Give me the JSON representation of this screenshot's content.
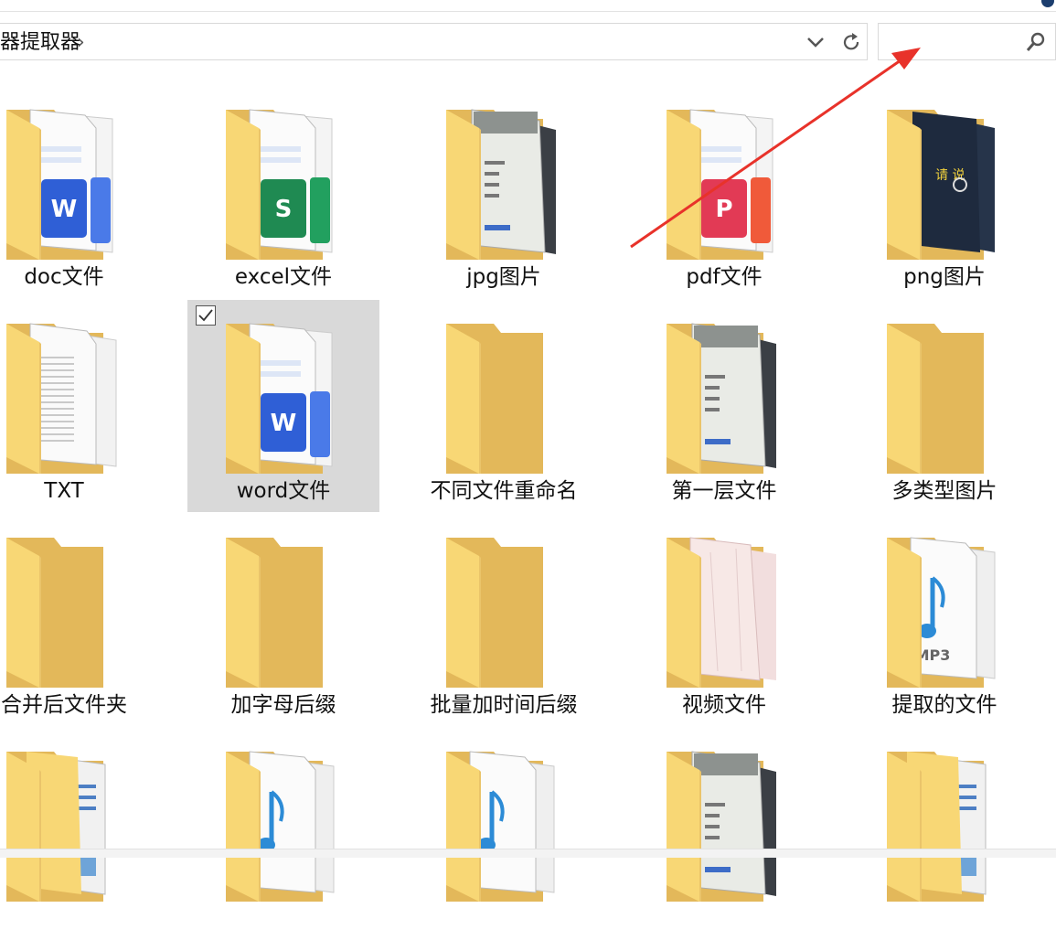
{
  "address_bar": {
    "breadcrumb": "器提取器",
    "separator": "›"
  },
  "search": {
    "placeholder": "",
    "value": ""
  },
  "colors": {
    "folder_back": "#e3b85a",
    "folder_front": "#f8d775",
    "selection": "#d9d9d9",
    "arrow": "#e8322a"
  },
  "items": [
    {
      "label": "doc文件",
      "thumb": "word-doc",
      "selected": false
    },
    {
      "label": "excel文件",
      "thumb": "excel-doc",
      "selected": false
    },
    {
      "label": "jpg图片",
      "thumb": "image-pages",
      "selected": false
    },
    {
      "label": "pdf文件",
      "thumb": "pdf-doc",
      "selected": false
    },
    {
      "label": "png图片",
      "thumb": "dark-image",
      "selected": false
    },
    {
      "label": "TXT",
      "thumb": "text-pages",
      "selected": false
    },
    {
      "label": "word文件",
      "thumb": "word-doc",
      "selected": true
    },
    {
      "label": "不同文件重命名",
      "thumb": "empty",
      "selected": false
    },
    {
      "label": "第一层文件",
      "thumb": "image-pages",
      "selected": false
    },
    {
      "label": "多类型图片",
      "thumb": "empty",
      "selected": false
    },
    {
      "label": "合并后文件夹",
      "thumb": "empty",
      "selected": false
    },
    {
      "label": "加字母后缀",
      "thumb": "empty",
      "selected": false
    },
    {
      "label": "批量加时间后缀",
      "thumb": "empty",
      "selected": false
    },
    {
      "label": "视频文件",
      "thumb": "pink-pages",
      "selected": false
    },
    {
      "label": "提取的文件",
      "thumb": "mp3-doc",
      "selected": false
    },
    {
      "label": "",
      "thumb": "blue-doc",
      "selected": false
    },
    {
      "label": "",
      "thumb": "music-doc",
      "selected": false
    },
    {
      "label": "",
      "thumb": "music-doc",
      "selected": false
    },
    {
      "label": "",
      "thumb": "image-pages",
      "selected": false
    },
    {
      "label": "",
      "thumb": "blue-doc",
      "selected": false
    }
  ]
}
